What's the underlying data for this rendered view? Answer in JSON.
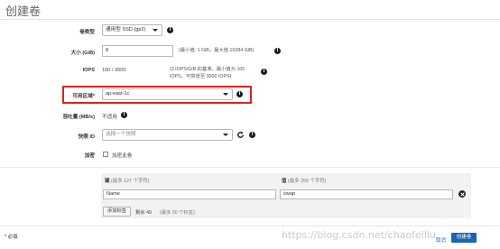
{
  "page": {
    "title": "创建卷"
  },
  "form": {
    "volume_type": {
      "label": "卷类型",
      "value": "通用型 SSD (gp2)"
    },
    "size": {
      "label": "大小 (GiB)",
      "value": "8",
      "hint": "(最小值: 1 GiB，最大值 16384 GiB)"
    },
    "iops": {
      "label": "IOPS",
      "value": "100 / 3000",
      "hint_line1": "(3 IOPS/GiB 的基准，最小值为 100",
      "hint_line2": "IOPS，可突增至 3000 IOPS)"
    },
    "availability_zone": {
      "label": "可用区域*",
      "value": "ap-east-1c",
      "highlight_color": "#e02020"
    },
    "throughput": {
      "label": "吞吐量 (MB/s)",
      "value": "不适用"
    },
    "snapshot": {
      "label": "快照 ID",
      "placeholder": "选择一个快照"
    },
    "encryption": {
      "label": "加密",
      "checkbox_label": "加密此卷"
    }
  },
  "tags": {
    "key_header": "键",
    "key_hint": "(最多 127 个字符)",
    "value_header": "值",
    "value_hint": "(最多 255 个字符)",
    "rows": [
      {
        "key": "Name",
        "value": "swap"
      }
    ],
    "add_button": "添加标签",
    "remaining": "剩余 49",
    "remaining_hint": "(最多 50 个标签)"
  },
  "footer": {
    "required_note": "* 必填",
    "cancel": "取消",
    "create": "创建卷",
    "primary_color": "#1a64b3"
  },
  "watermark": "https://blog.csdn.net/chaofeiliu"
}
